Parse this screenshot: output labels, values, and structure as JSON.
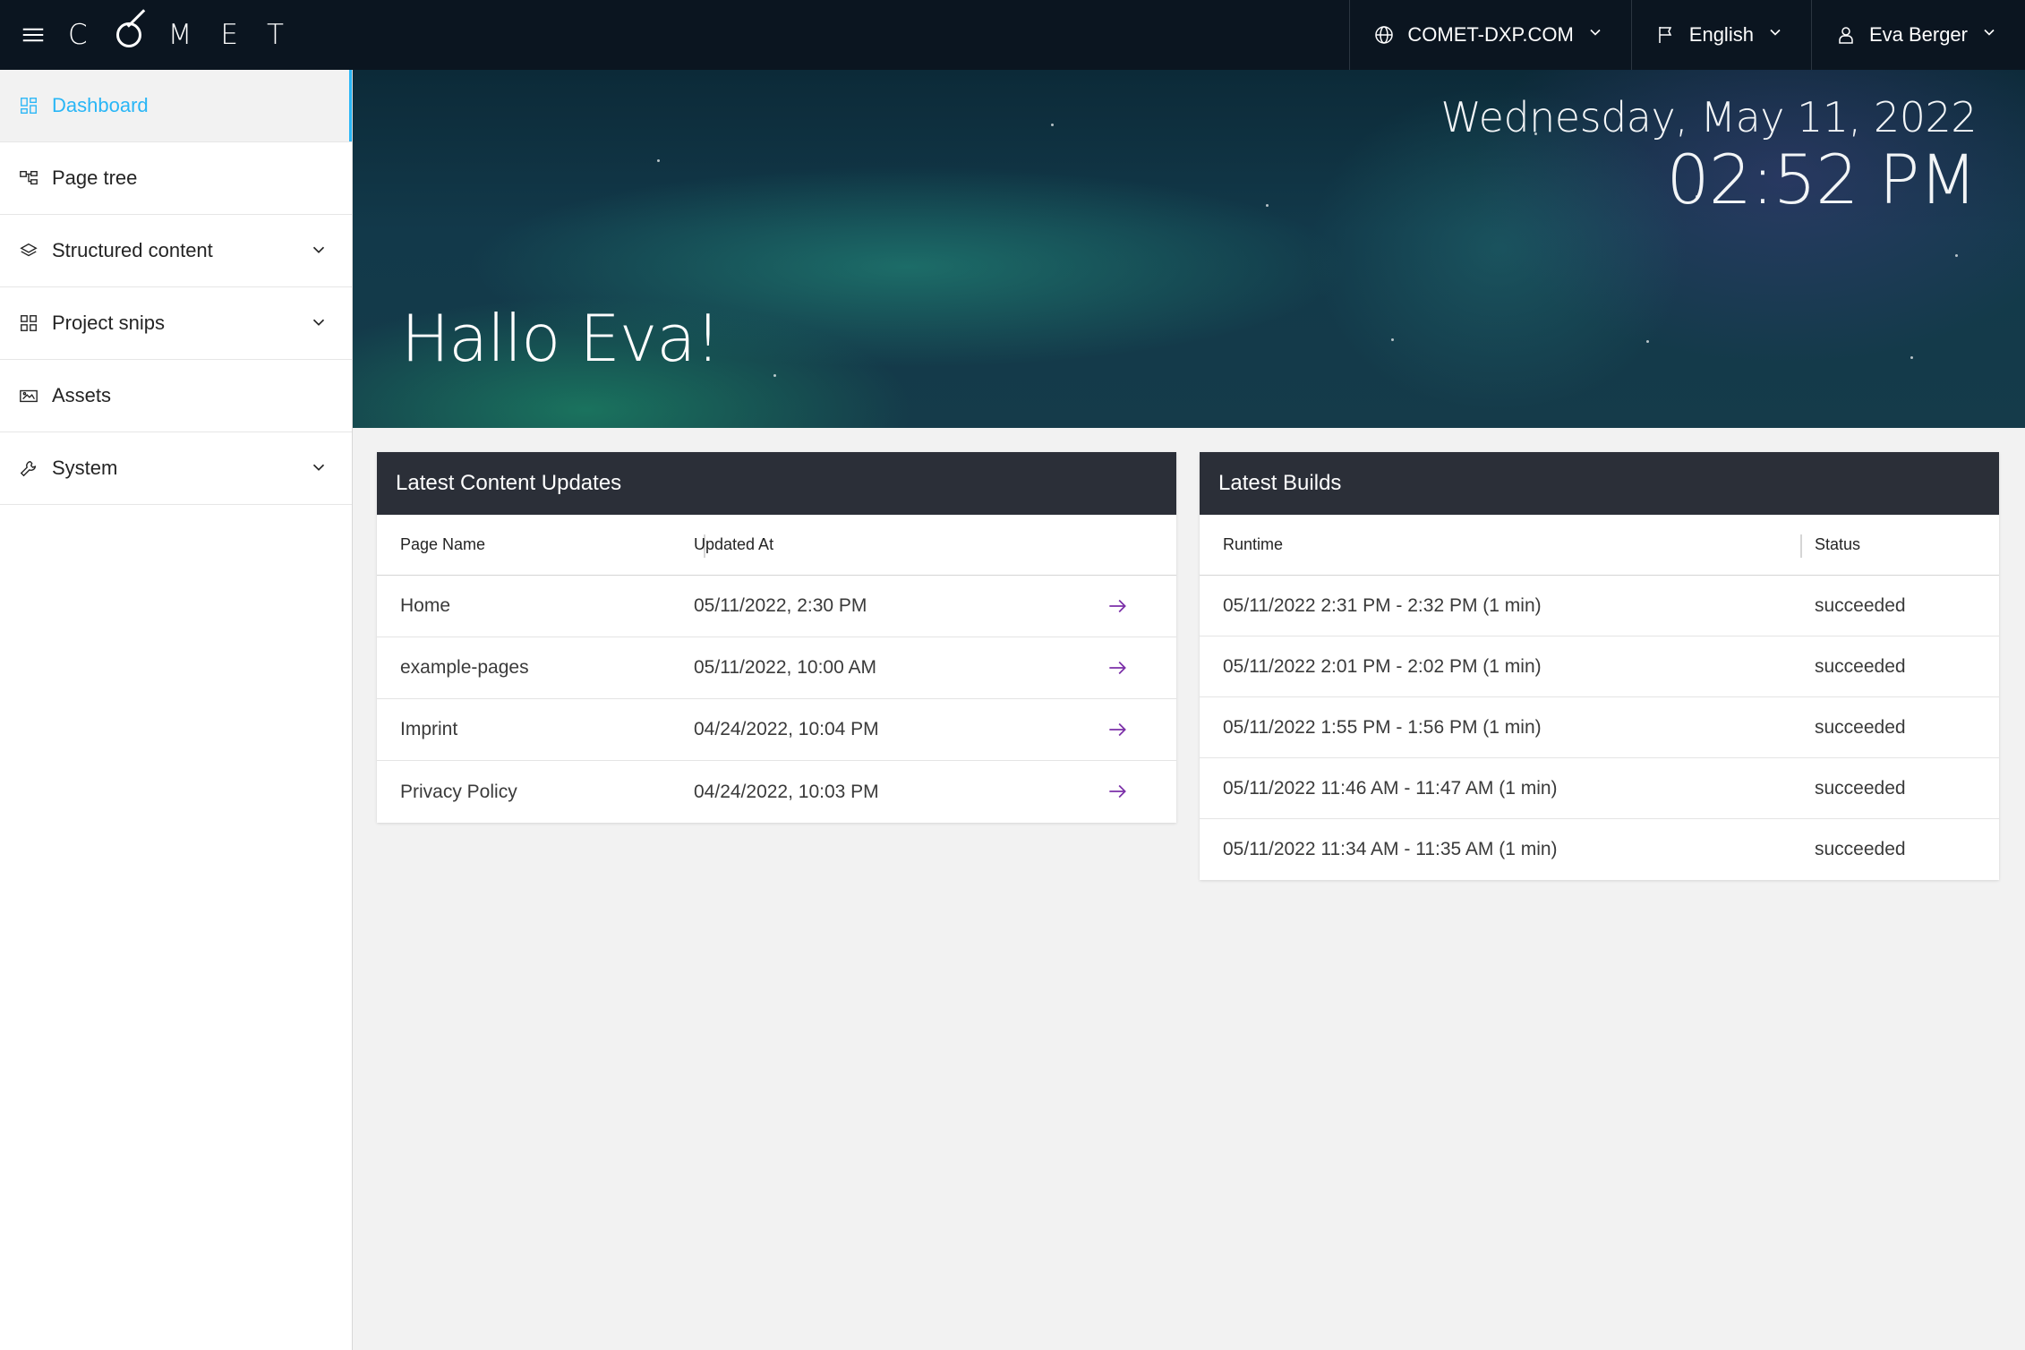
{
  "topbar": {
    "logo_text": "COMET",
    "domain": "COMET-DXP.COM",
    "language": "English",
    "user": "Eva Berger"
  },
  "sidebar": {
    "items": [
      {
        "label": "Dashboard",
        "icon": "dashboard-icon",
        "active": true
      },
      {
        "label": "Page tree",
        "icon": "page-tree-icon"
      },
      {
        "label": "Structured content",
        "icon": "layers-icon",
        "expandable": true
      },
      {
        "label": "Project snips",
        "icon": "snips-icon",
        "expandable": true
      },
      {
        "label": "Assets",
        "icon": "assets-icon"
      },
      {
        "label": "System",
        "icon": "wrench-icon",
        "expandable": true
      }
    ]
  },
  "hero": {
    "date": "Wednesday, May 11, 2022",
    "time": "02:52 PM",
    "greeting": "Hallo Eva!"
  },
  "content_updates": {
    "title": "Latest Content Updates",
    "columns": [
      "Page Name",
      "Updated At"
    ],
    "rows": [
      {
        "name": "Home",
        "updated": "05/11/2022, 2:30 PM"
      },
      {
        "name": "example-pages",
        "updated": "05/11/2022, 10:00 AM"
      },
      {
        "name": "Imprint",
        "updated": "04/24/2022, 10:04 PM"
      },
      {
        "name": "Privacy Policy",
        "updated": "04/24/2022, 10:03 PM"
      }
    ]
  },
  "builds": {
    "title": "Latest Builds",
    "columns": [
      "Runtime",
      "Status"
    ],
    "rows": [
      {
        "runtime": "05/11/2022 2:31 PM - 2:32 PM (1 min)",
        "status": "succeeded"
      },
      {
        "runtime": "05/11/2022 2:01 PM - 2:02 PM (1 min)",
        "status": "succeeded"
      },
      {
        "runtime": "05/11/2022 1:55 PM - 1:56 PM (1 min)",
        "status": "succeeded"
      },
      {
        "runtime": "05/11/2022 11:46 AM - 11:47 AM (1 min)",
        "status": "succeeded"
      },
      {
        "runtime": "05/11/2022 11:34 AM - 11:35 AM (1 min)",
        "status": "succeeded"
      }
    ]
  },
  "colors": {
    "accent": "#29b6f6",
    "topbar": "#0b1520",
    "card_header": "#2b2f38",
    "arrow": "#7b2fa8"
  }
}
